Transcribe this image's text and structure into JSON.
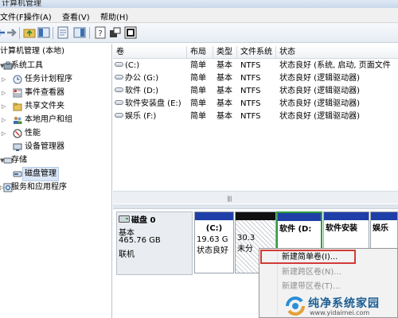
{
  "window": {
    "title": "计算机管理"
  },
  "menu": [
    "文件(F)",
    "操作(A)",
    "查看(V)",
    "帮助(H)"
  ],
  "toolbar": {
    "icons": [
      "back-arrow-icon",
      "forward-arrow-icon",
      "up-folder-icon",
      "console-tree-icon",
      "help-icon",
      "properties-icon",
      "refresh-icon",
      "export-icon",
      "view-icon"
    ]
  },
  "tree": {
    "root": "计算机管理 (本地)",
    "system_tools": "系统工具",
    "task_scheduler": "任务计划程序",
    "event_viewer": "事件查看器",
    "shared_folders": "共享文件夹",
    "local_users": "本地用户和组",
    "performance": "性能",
    "device_manager": "设备管理器",
    "storage": "存储",
    "disk_management": "磁盘管理",
    "services": "服务和应用程序"
  },
  "volume_table": {
    "headers": [
      "卷",
      "布局",
      "类型",
      "文件系统",
      "状态"
    ],
    "rows": [
      [
        "(C:)",
        "简单",
        "基本",
        "NTFS",
        "状态良好 (系统, 启动, 页面文件"
      ],
      [
        "办公 (G:)",
        "简单",
        "基本",
        "NTFS",
        "状态良好 (逻辑驱动器)"
      ],
      [
        "软件 (D:)",
        "简单",
        "基本",
        "NTFS",
        "状态良好 (逻辑驱动器)"
      ],
      [
        "软件安装盘 (E:)",
        "简单",
        "基本",
        "NTFS",
        "状态良好 (逻辑驱动器)"
      ],
      [
        "娱乐 (F:)",
        "简单",
        "基本",
        "NTFS",
        "状态良好 (逻辑驱动器)"
      ]
    ]
  },
  "disk": {
    "name": "磁盘 0",
    "type": "基本",
    "size": "465.76 GB",
    "status": "联机",
    "partitions": [
      {
        "label": "(C:)",
        "size": "19.63 G",
        "status": "状态良好"
      },
      {
        "label": "",
        "size": "30.3",
        "status": "未分"
      },
      {
        "label": "软件 (D:",
        "size": "",
        "status": ""
      },
      {
        "label": "软件安装",
        "size": "",
        "status": ""
      },
      {
        "label": "娱乐",
        "size": "",
        "status": ""
      }
    ]
  },
  "context_menu": {
    "items": [
      {
        "label": "新建简单卷(I)...",
        "enabled": true
      },
      {
        "label": "新建跨区卷(N)...",
        "enabled": false
      },
      {
        "label": "新建带区卷(T)...",
        "enabled": false
      }
    ]
  },
  "watermark": {
    "title": "纯净系统家园",
    "url": "www.yidaimei.com"
  },
  "colors": {
    "primary_band": "#1f3fa8",
    "unallocated_band": "#101010",
    "logical_band": "#1f3fa8",
    "selection_outline": "#2e9e3e",
    "highlight_box": "#d23b36"
  }
}
